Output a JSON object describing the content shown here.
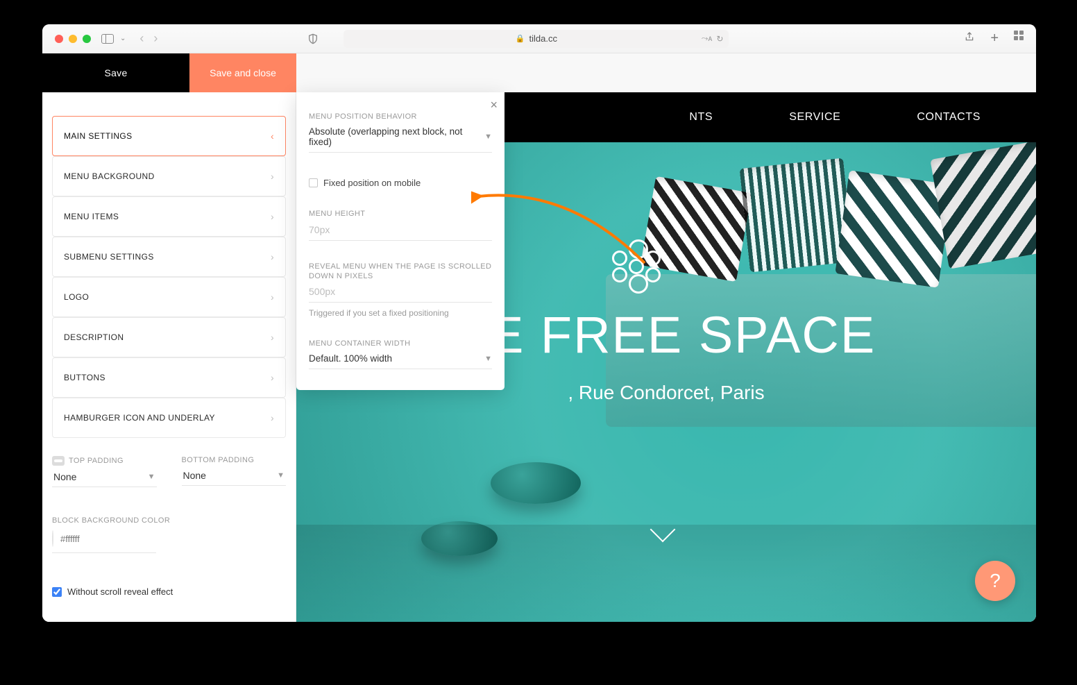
{
  "browser": {
    "url_domain": "tilda.cc"
  },
  "top_buttons": {
    "save": "Save",
    "save_and_close": "Save and close"
  },
  "accordion": [
    "MAIN SETTINGS",
    "MENU BACKGROUND",
    "MENU ITEMS",
    "SUBMENU SETTINGS",
    "LOGO",
    "DESCRIPTION",
    "BUTTONS",
    "HAMBURGER ICON AND UNDERLAY"
  ],
  "padding": {
    "top_label": "TOP PADDING",
    "bottom_label": "BOTTOM PADDING",
    "top_value": "None",
    "bottom_value": "None"
  },
  "block_bg": {
    "label": "BLOCK BACKGROUND COLOR",
    "hex_placeholder": "#ffffff"
  },
  "scroll_reveal_checkbox": {
    "label": "Without scroll reveal effect",
    "checked": true
  },
  "popover": {
    "position_label": "MENU POSITION BEHAVIOR",
    "position_value": "Absolute (overlapping next block, not fixed)",
    "fixed_mobile_label": "Fixed position on mobile",
    "height_label": "MENU HEIGHT",
    "height_placeholder": "70px",
    "reveal_label": "REVEAL MENU WHEN THE PAGE IS SCROLLED DOWN N PIXELS",
    "reveal_placeholder": "500px",
    "reveal_helper": "Triggered if you set a fixed positioning",
    "container_label": "MENU CONTAINER WIDTH",
    "container_value": "Default. 100% width"
  },
  "preview": {
    "nav_items": [
      "NTS",
      "SERVICE",
      "CONTACTS"
    ],
    "headline": "FE FREE SPACE",
    "subline": ", Rue Condorcet, Paris"
  },
  "help_fab": "?"
}
